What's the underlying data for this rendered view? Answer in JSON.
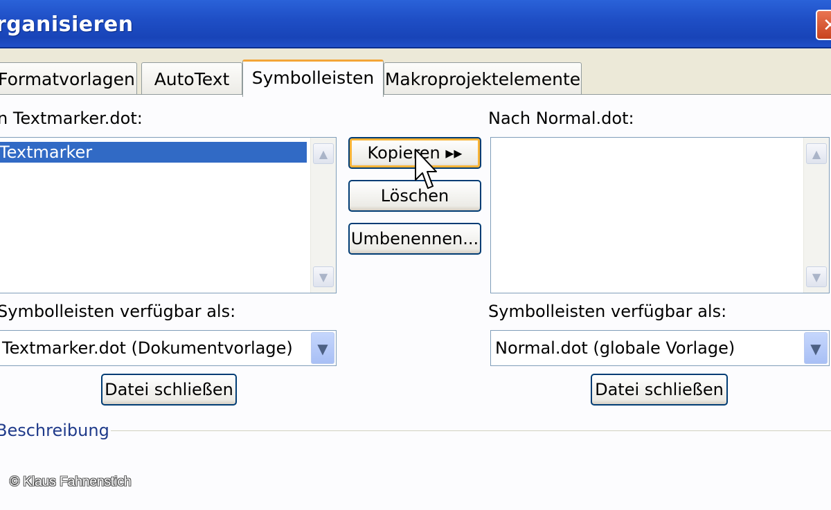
{
  "window": {
    "title": "rganisieren",
    "close_glyph": "✕"
  },
  "tabs": [
    {
      "label": "Formatvorlagen"
    },
    {
      "label": "AutoText"
    },
    {
      "label": "Symbolleisten",
      "active": true
    },
    {
      "label": "Makroprojektelemente"
    }
  ],
  "left": {
    "list_label": "n Textmarker.dot:",
    "items": [
      "Textmarker"
    ],
    "available_label": "Symbolleisten verfügbar als:",
    "available_value": "Textmarker.dot (Dokumentvorlage)",
    "close_file": "Datei schließen"
  },
  "right": {
    "list_label": "Nach Normal.dot:",
    "items": [],
    "available_label": "Symbolleisten verfügbar als:",
    "available_value": "Normal.dot (globale Vorlage)",
    "close_file": "Datei schließen"
  },
  "actions": {
    "copy": "Kopieren ▸▸",
    "delete": "Löschen",
    "rename": "Umbenennen..."
  },
  "description": {
    "label": "Beschreibung"
  },
  "watermark": "© Klaus Fahnenstich",
  "colors": {
    "titlebar": "#1f4fc6",
    "selection": "#316ac5",
    "focus": "#f8b336",
    "tab_active_top": "#f3a538"
  }
}
